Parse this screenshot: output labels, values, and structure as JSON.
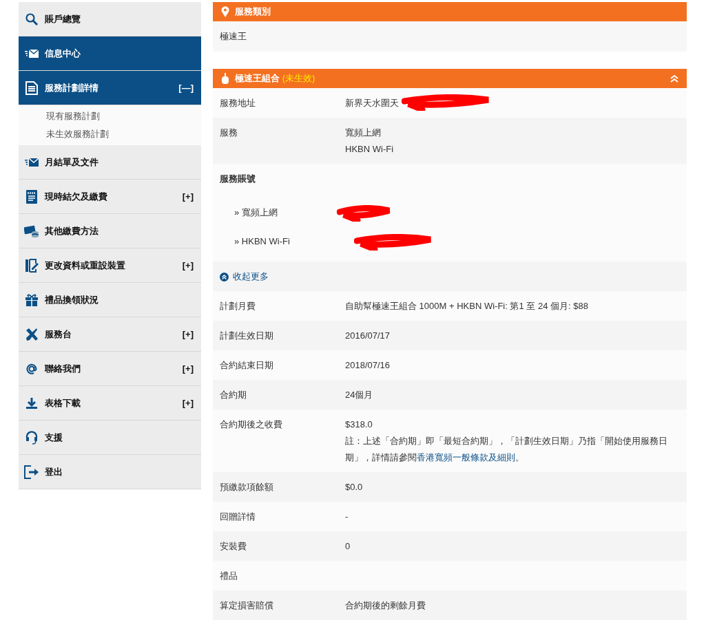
{
  "sidebar": {
    "items": [
      {
        "label": "賬戶總覽",
        "selected": false
      },
      {
        "label": "信息中心",
        "selected": true
      },
      {
        "label": "服務計劃詳情",
        "selected": true,
        "toggle": "[—]",
        "children": [
          {
            "label": "現有服務計劃"
          },
          {
            "label": "未生效服務計劃"
          }
        ]
      },
      {
        "label": "月結單及文件",
        "selected": false
      },
      {
        "label": "現時結欠及繳費",
        "selected": false,
        "toggle": "[+]"
      },
      {
        "label": "其他繳費方法",
        "selected": false
      },
      {
        "label": "更改資料或重設裝置",
        "selected": false,
        "toggle": "[+]"
      },
      {
        "label": "禮品換領狀況",
        "selected": false
      },
      {
        "label": "服務台",
        "selected": false,
        "toggle": "[+]"
      },
      {
        "label": "聯絡我們",
        "selected": false,
        "toggle": "[+]"
      },
      {
        "label": "表格下載",
        "selected": false,
        "toggle": "[+]"
      },
      {
        "label": "支援",
        "selected": false
      },
      {
        "label": "登出",
        "selected": false
      }
    ]
  },
  "service_type": {
    "title": "服務類別",
    "value": "極速王"
  },
  "plan": {
    "title": "極速王組合",
    "status": "(未生效)",
    "rows": [
      {
        "kind": "field",
        "label": "服務地址",
        "values": [
          "新界天水圍天"
        ],
        "redacted": true
      },
      {
        "kind": "field",
        "label": "服務",
        "values": [
          "寬頻上網",
          "HKBN Wi-Fi"
        ]
      },
      {
        "kind": "accounts",
        "label": "服務賬號",
        "items": [
          {
            "label": "» 寬頻上網"
          },
          {
            "label": "» HKBN Wi-Fi"
          }
        ]
      },
      {
        "kind": "collapse",
        "label": "收起更多"
      },
      {
        "kind": "field",
        "label": "計劃月費",
        "values": [
          "自助幫極速王組合 1000M + HKBN Wi-Fi: 第1 至 24 個月: $88"
        ]
      },
      {
        "kind": "field",
        "label": "計劃生效日期",
        "values": [
          "2016/07/17"
        ]
      },
      {
        "kind": "field",
        "label": "合約結束日期",
        "values": [
          "2018/07/16"
        ]
      },
      {
        "kind": "field",
        "label": "合約期",
        "values": [
          "24個月"
        ]
      },
      {
        "kind": "note",
        "label": "合約期後之收費",
        "values": [
          "$318.0"
        ],
        "note": "註：上述「合約期」即「最短合約期」，「計劃生效日期」乃指「開始使用服務日期」，詳情請參閱",
        "link": "香港寬頻一般條款及細則",
        "note_end": "。"
      },
      {
        "kind": "field",
        "label": "預繳款項餘額",
        "values": [
          "$0.0"
        ]
      },
      {
        "kind": "field",
        "label": "回贈詳情",
        "values": [
          "-"
        ]
      },
      {
        "kind": "field",
        "label": "安裝費",
        "values": [
          "0"
        ]
      },
      {
        "kind": "field",
        "label": "禮品",
        "values": []
      },
      {
        "kind": "field",
        "label": "算定損害賠償",
        "values": [
          "合約期後的剩餘月費"
        ]
      }
    ]
  }
}
